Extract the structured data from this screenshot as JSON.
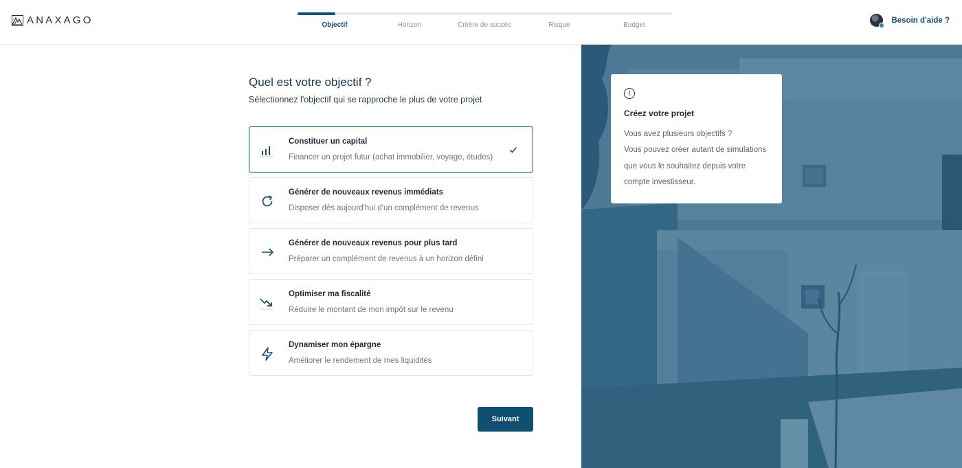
{
  "brand": {
    "name": "ANAXAGO"
  },
  "stepper": {
    "progress": 0.1,
    "steps": [
      {
        "label": "Objectif",
        "active": true
      },
      {
        "label": "Horizon",
        "active": false
      },
      {
        "label": "Critère de succès",
        "active": false
      },
      {
        "label": "Risque",
        "active": false
      },
      {
        "label": "Budget",
        "active": false
      }
    ]
  },
  "help": {
    "label": "Besoin d'aide ?"
  },
  "form": {
    "title": "Quel est votre objectif ?",
    "subtitle": "Sélectionnez l'objectif qui se rapproche le plus de votre projet",
    "options": [
      {
        "icon": "bar-chart-icon",
        "title": "Constituer un capital",
        "description": "Financer un projet futur (achat immobilier, voyage, études)",
        "selected": true
      },
      {
        "icon": "refresh-icon",
        "title": "Générer de nouveaux revenus immédiats",
        "description": "Disposer dès aujourd'hui d'un complément de revenus",
        "selected": false
      },
      {
        "icon": "arrow-right-icon",
        "title": "Générer de nouveaux revenus pour plus tard",
        "description": "Préparer un complément de revenus à un horizon défini",
        "selected": false
      },
      {
        "icon": "trending-down-icon",
        "title": "Optimiser ma fiscalité",
        "description": "Réduire le montant de mon impôt sur le revenu",
        "selected": false
      },
      {
        "icon": "lightning-icon",
        "title": "Dynamiser mon épargne",
        "description": "Améliorer le rendement de mes liquidités",
        "selected": false
      }
    ],
    "next_label": "Suivant"
  },
  "info_card": {
    "icon": "info-icon",
    "title": "Créez votre projet",
    "lines": [
      "Vous avez plusieurs objectifs ?",
      "Vous pouvez créer autant de simulations",
      "que vous le souhaitez depuis votre",
      "compte investisseur."
    ]
  },
  "colors": {
    "primary": "#0e4f72",
    "progress_fill": "#0e5479",
    "text": "#1c2b39",
    "muted": "#6d7882",
    "photo_tint": "#3f6f8c"
  }
}
